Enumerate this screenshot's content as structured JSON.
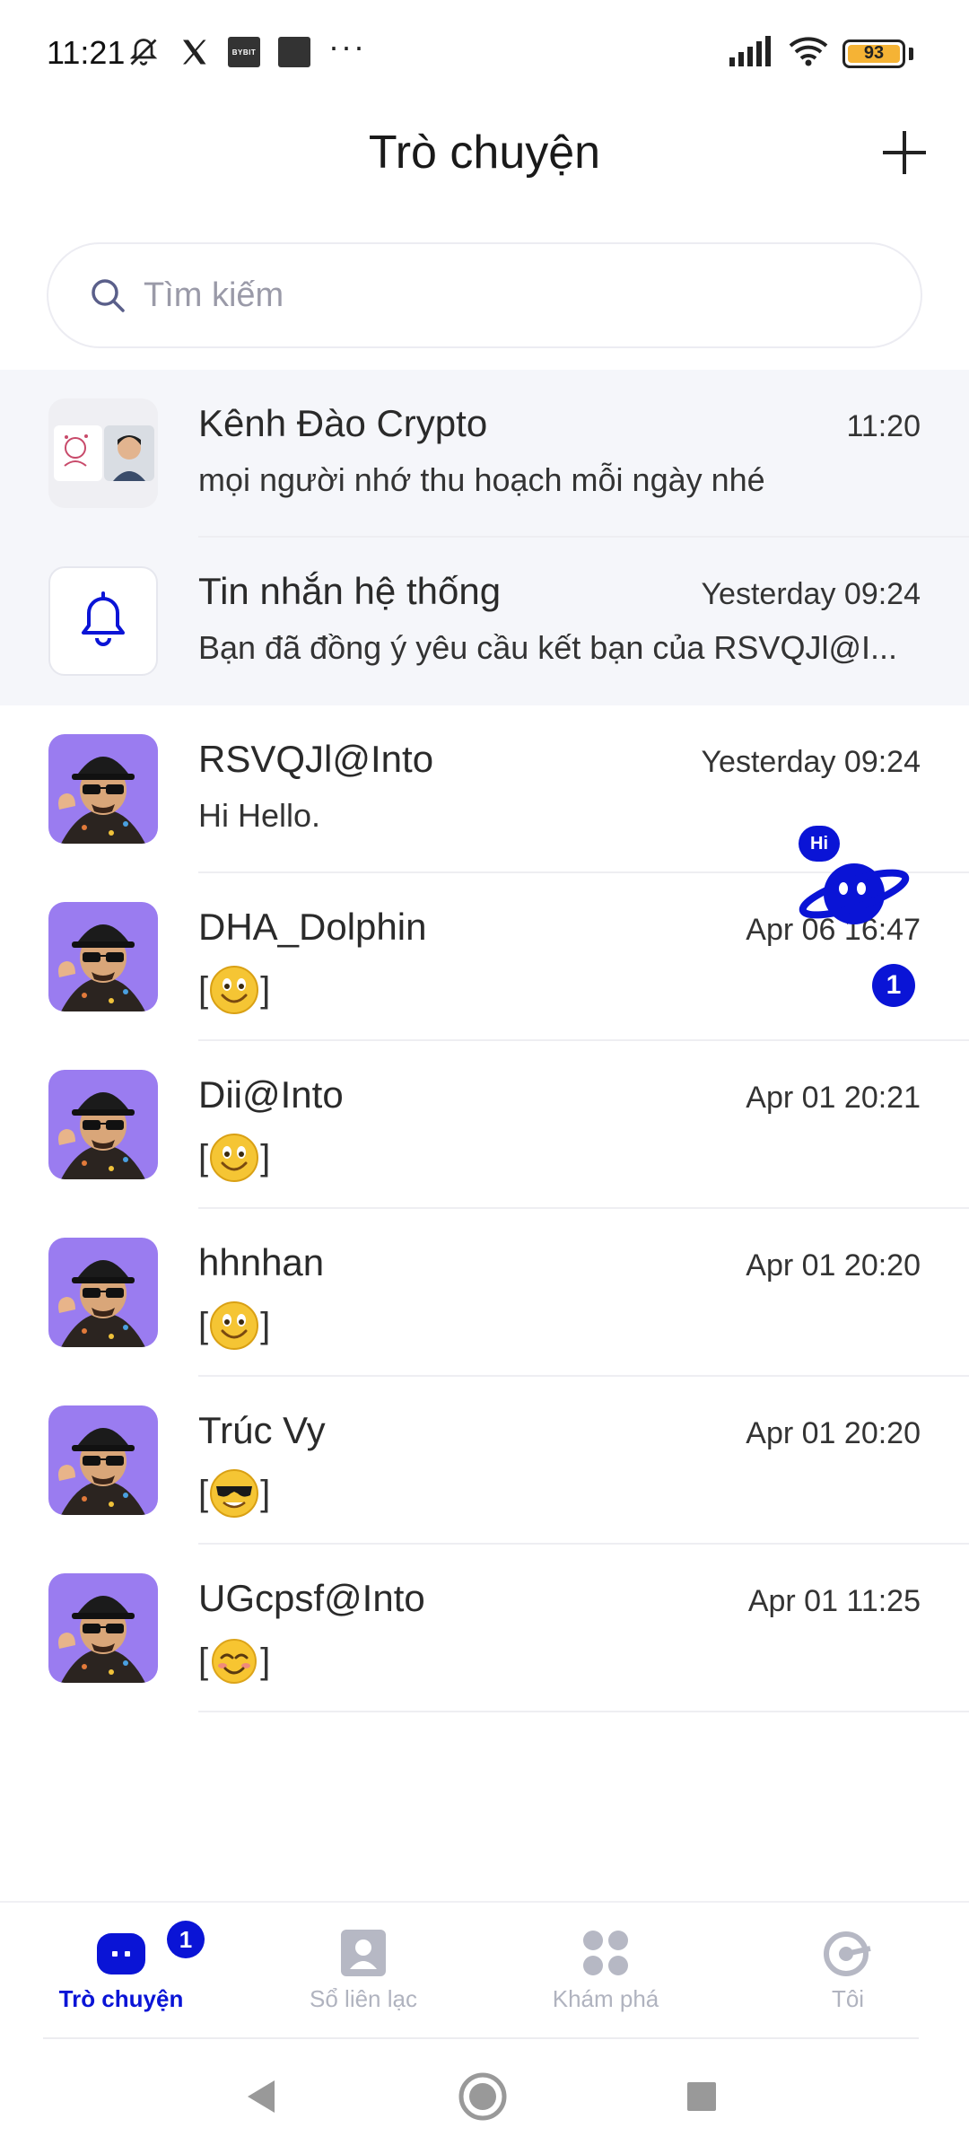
{
  "status_bar": {
    "time": "11:21",
    "left_icons": [
      "bell-off-icon",
      "x-logo-icon",
      "bybit-icon",
      "app-icon",
      "more-dots-icon"
    ],
    "bybit_text": "BYBIT",
    "more": "···",
    "battery": "93",
    "battery_color": "#f5b335"
  },
  "header": {
    "title": "Trò chuyện",
    "add_icon": "plus-icon"
  },
  "search": {
    "placeholder": "Tìm kiếm"
  },
  "conversations": [
    {
      "name": "Kênh Đào Crypto",
      "time": "11:20",
      "message": "mọi người nhớ thu hoạch mỗi ngày nhé",
      "avatar": "group-avatar",
      "shaded": true
    },
    {
      "name": "Tin nhắn hệ thống",
      "time": "Yesterday 09:24",
      "message": "Bạn đã đồng ý yêu cầu kết bạn của RSVQJl@I...",
      "avatar": "bell-icon",
      "shaded": true
    },
    {
      "name": "RSVQJl@Into",
      "time": "Yesterday 09:24",
      "message": "Hi Hello.",
      "avatar": "character-avatar"
    },
    {
      "name": "DHA_Dolphin",
      "time": "Apr 06 16:47",
      "message_emoji": "smile-emoji",
      "avatar": "character-avatar"
    },
    {
      "name": "Dii@Into",
      "time": "Apr 01 20:21",
      "message_emoji": "smile-emoji",
      "avatar": "character-avatar"
    },
    {
      "name": "hhnhan",
      "time": "Apr 01 20:20",
      "message_emoji": "smile-emoji",
      "avatar": "character-avatar"
    },
    {
      "name": "Trúc Vy",
      "time": "Apr 01 20:20",
      "message_emoji": "sunglasses-emoji",
      "avatar": "character-avatar"
    },
    {
      "name": "UGcpsf@Into",
      "time": "Apr 01 11:25",
      "message_emoji": "blush-emoji",
      "avatar": "character-avatar"
    }
  ],
  "floating_assistant": {
    "bubble": "Hi",
    "badge": "1"
  },
  "bottom_nav": [
    {
      "label": "Trò chuyện",
      "icon": "chat-icon",
      "active": true,
      "badge": "1"
    },
    {
      "label": "Sổ liên lạc",
      "icon": "contacts-icon",
      "active": false
    },
    {
      "label": "Khám phá",
      "icon": "discover-icon",
      "active": false
    },
    {
      "label": "Tôi",
      "icon": "profile-icon",
      "active": false
    }
  ],
  "colors": {
    "accent": "#0a14d6",
    "avatar_bg": "#9a7cf0",
    "shaded_row": "#f5f6fa"
  }
}
